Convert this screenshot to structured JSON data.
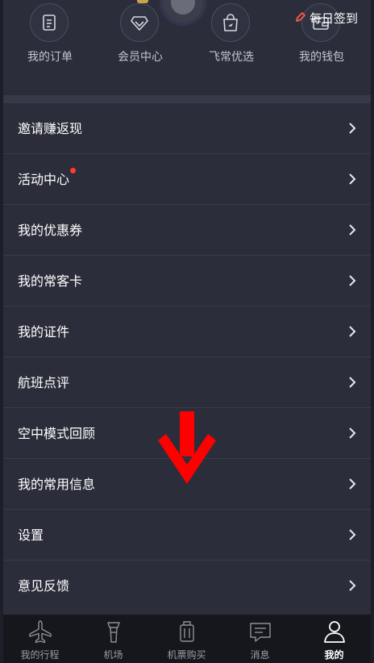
{
  "header": {
    "signin_label": "每日签到",
    "shortcuts": [
      {
        "label": "我的订单",
        "icon": "order-list-icon"
      },
      {
        "label": "会员中心",
        "icon": "diamond-icon"
      },
      {
        "label": "飞常优选",
        "icon": "shopping-bag-plane-icon"
      },
      {
        "label": "我的钱包",
        "icon": "wallet-icon"
      }
    ]
  },
  "menu": {
    "items": [
      {
        "label": "邀请赚返现"
      },
      {
        "label": "活动中心",
        "badge": "red-dot"
      },
      {
        "label": "我的优惠券"
      },
      {
        "label": "我的常客卡"
      },
      {
        "label": "我的证件"
      },
      {
        "label": "航班点评"
      },
      {
        "label": "空中模式回顾"
      },
      {
        "label": "我的常用信息"
      },
      {
        "label": "设置"
      },
      {
        "label": "意见反馈"
      }
    ]
  },
  "tabbar": {
    "tabs": [
      {
        "label": "我的行程",
        "icon": "airplane-icon"
      },
      {
        "label": "机场",
        "icon": "control-tower-icon"
      },
      {
        "label": "机票购买",
        "icon": "luggage-icon"
      },
      {
        "label": "消息",
        "icon": "message-icon"
      },
      {
        "label": "我的",
        "icon": "person-icon",
        "active": true
      }
    ]
  },
  "colors": {
    "background": "#2b2d3a",
    "accent_red": "#ff3b30",
    "annotation_arrow": "#ff0000",
    "tabbar": "#16171d"
  }
}
